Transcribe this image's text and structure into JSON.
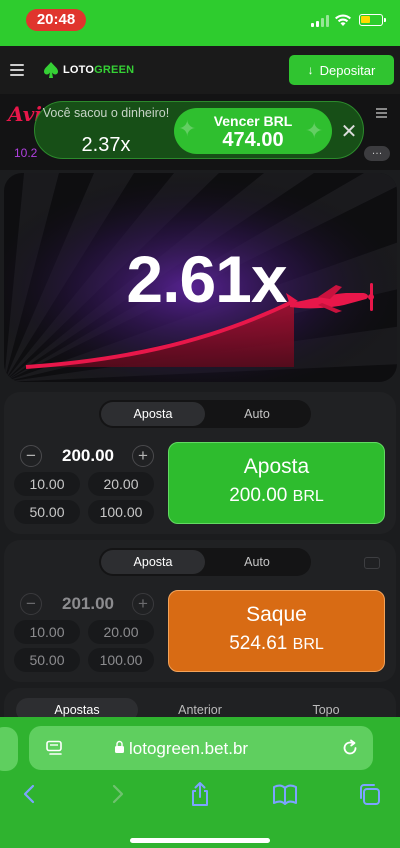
{
  "status_bar": {
    "time": "20:48"
  },
  "header": {
    "logo": "LOTOGREEN",
    "deposit_label": "Depositar"
  },
  "game": {
    "logo_text": "Aviator",
    "history_first": "10.2",
    "multiplier": "2.61x"
  },
  "toast": {
    "label": "Você sacou o dinheiro!",
    "multiplier": "2.37x",
    "win_label": "Vencer BRL",
    "win_amount": "474.00",
    "close": "✕"
  },
  "bet_panels": [
    {
      "tabs": [
        "Aposta",
        "Auto"
      ],
      "active_tab": "Aposta",
      "amount": "200.00",
      "quick_amounts": [
        "10.00",
        "20.00",
        "50.00",
        "100.00"
      ],
      "button_title": "Aposta",
      "button_amount": "200.00",
      "button_currency": "BRL",
      "button_color": "#2ebc2e"
    },
    {
      "tabs": [
        "Aposta",
        "Auto"
      ],
      "active_tab": "Aposta",
      "amount": "201.00",
      "quick_amounts": [
        "10.00",
        "20.00",
        "50.00",
        "100.00"
      ],
      "button_title": "Saque",
      "button_amount": "524.61",
      "button_currency": "BRL",
      "button_color": "#d86b14"
    }
  ],
  "bottom_tabs": {
    "items": [
      "Apostas",
      "Anterior",
      "Topo"
    ],
    "active": "Apostas"
  },
  "browser": {
    "url": "lotogreen.bet.br"
  },
  "colors": {
    "brand_green": "#2fb32f",
    "plane_red": "#e8174a",
    "cashout_orange": "#d86b14"
  }
}
